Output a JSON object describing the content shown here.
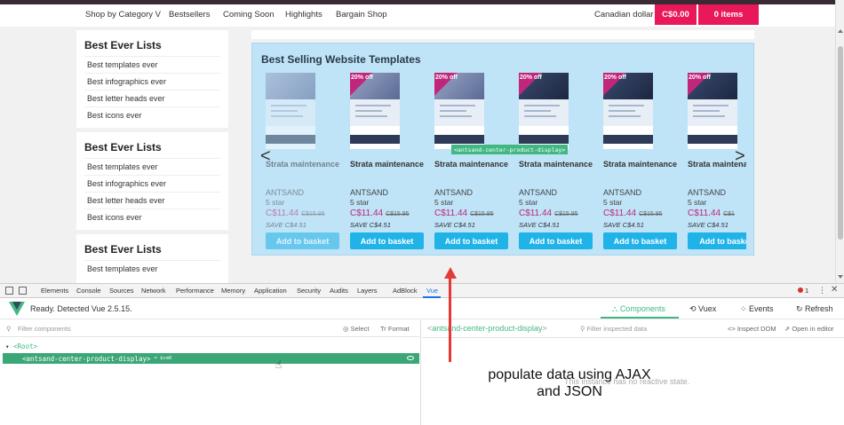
{
  "nav": {
    "items": [
      "Shop by Category V",
      "Bestsellers",
      "Coming Soon",
      "Highlights",
      "Bargain Shop"
    ],
    "currency": "Canadian dollar",
    "cart_total": "C$0.00",
    "cart_items": "0 items"
  },
  "sidebar": [
    {
      "title": "Best Ever Lists",
      "items": [
        "Best templates ever",
        "Best infographics ever",
        "Best letter heads ever",
        "Best icons ever"
      ]
    },
    {
      "title": "Best Ever Lists",
      "items": [
        "Best templates ever",
        "Best infographics ever",
        "Best letter heads ever",
        "Best icons ever"
      ]
    },
    {
      "title": "Best Ever Lists",
      "items": [
        "Best templates ever"
      ]
    }
  ],
  "products_section": {
    "title": "Best Selling Website Templates",
    "prev_arrow": "<",
    "next_arrow": ">",
    "component_tag": "<antsand-center-product-display>",
    "products": [
      {
        "badge": "",
        "name": "Strata maintenance",
        "brand": "ANTSAND",
        "rating": "5 star",
        "price": "C$11.44",
        "old_price": "C$15.95",
        "save": "SAVE C$4.51",
        "button": "Add to basket"
      },
      {
        "badge": "20% off",
        "name": "Strata maintenance",
        "brand": "ANTSAND",
        "rating": "5 star",
        "price": "C$11.44",
        "old_price": "C$15.95",
        "save": "SAVE C$4.51",
        "button": "Add to basket"
      },
      {
        "badge": "20% off",
        "name": "Strata maintenance",
        "brand": "ANTSAND",
        "rating": "5 star",
        "price": "C$11.44",
        "old_price": "C$15.95",
        "save": "SAVE C$4.51",
        "button": "Add to basket"
      },
      {
        "badge": "20% off",
        "name": "Strata maintenance",
        "brand": "ANTSAND",
        "rating": "5 star",
        "price": "C$11.44",
        "old_price": "C$15.95",
        "save": "SAVE C$4.51",
        "button": "Add to basket"
      },
      {
        "badge": "20% off",
        "name": "Strata maintenance",
        "brand": "ANTSAND",
        "rating": "5 star",
        "price": "C$11.44",
        "old_price": "C$15.95",
        "save": "SAVE C$4.51",
        "button": "Add to basket"
      },
      {
        "badge": "20% off",
        "name": "Strata maintenance",
        "brand": "ANTSAND",
        "rating": "5 star",
        "price": "C$11.44",
        "old_price": "C$1",
        "save": "SAVE C$4.51",
        "button": "Add to baske"
      }
    ]
  },
  "devtools": {
    "tabs": [
      "Elements",
      "Console",
      "Sources",
      "Network",
      "Performance",
      "Memory",
      "Application",
      "Security",
      "Audits",
      "Layers",
      "AdBlock",
      "Vue"
    ],
    "active_tab": "Vue",
    "error_count": "1",
    "more": "⋮",
    "close": "✕"
  },
  "vue": {
    "status": "Ready. Detected Vue 2.5.15.",
    "tabs": [
      "Components",
      "Vuex",
      "Events",
      "Refresh"
    ],
    "filter_placeholder": "Filter components",
    "select_label": "Select",
    "format_label": "Format",
    "root_label": "<Root>",
    "component_label": "<antsand-center-product-display>",
    "component_vm": "= $vm0",
    "inspected_component": "antsand-center-product-display",
    "inspect_filter_placeholder": "Filter inspected data",
    "inspect_dom": "Inspect DOM",
    "open_in_editor": "Open in editor",
    "no_state": "This instance has no reactive state."
  },
  "annotation": {
    "line1": "populate data using AJAX",
    "line2": "and JSON",
    "color": "#e53935"
  },
  "colors": {
    "accent_pink": "#e8185a",
    "button_blue": "#20b3e8",
    "price_magenta": "#c0267a",
    "vue_green": "#41b883"
  }
}
